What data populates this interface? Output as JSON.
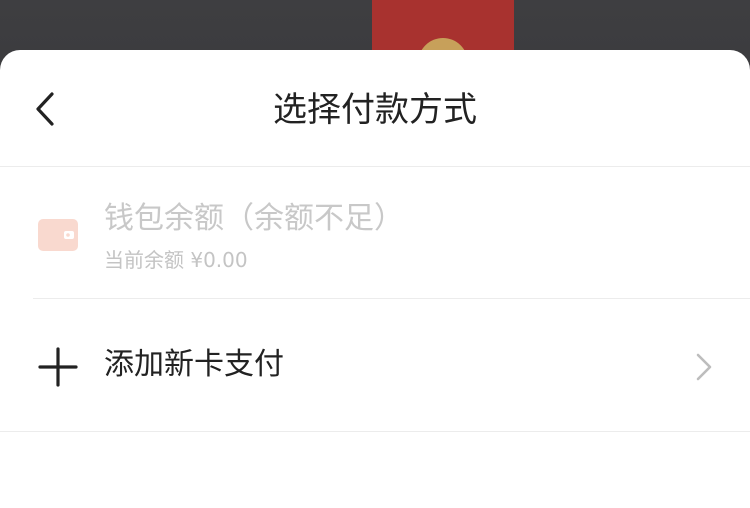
{
  "sheet": {
    "title": "选择付款方式",
    "back_icon": "chevron-left-icon"
  },
  "payment_methods": [
    {
      "icon": "wallet-icon",
      "title": "钱包余额（余额不足）",
      "subtitle": "当前余额 ¥0.00",
      "disabled": true,
      "icon_color": "#f9d9cf"
    },
    {
      "icon": "plus-icon",
      "title": "添加新卡支付",
      "trailing_icon": "chevron-right-icon"
    }
  ],
  "colors": {
    "backdrop": "#2c2c2e",
    "red_packet": "#a8322f",
    "text_primary": "#222222",
    "text_disabled": "#c8c8c8",
    "divider": "#ececec"
  }
}
